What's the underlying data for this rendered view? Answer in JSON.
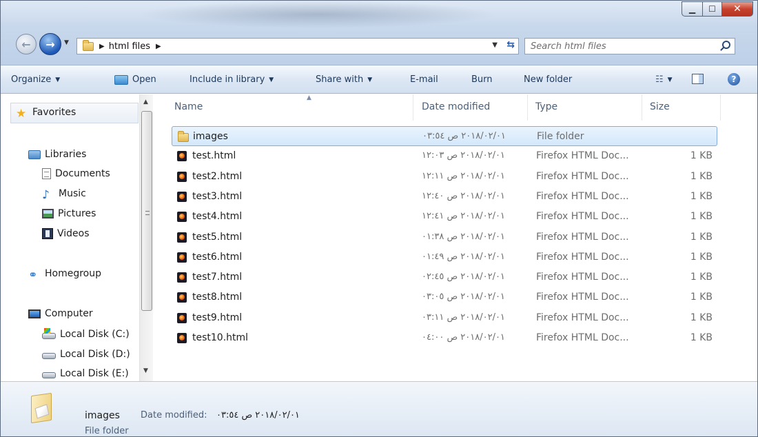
{
  "address": {
    "breadcrumbs": [
      "html files"
    ]
  },
  "search": {
    "placeholder": "Search html files"
  },
  "toolbar": {
    "organize": "Organize",
    "open": "Open",
    "include_in_library": "Include in library",
    "share_with": "Share with",
    "email": "E-mail",
    "burn": "Burn",
    "new_folder": "New folder"
  },
  "nav": {
    "favorites": "Favorites",
    "libraries": "Libraries",
    "documents": "Documents",
    "music": "Music",
    "pictures": "Pictures",
    "videos": "Videos",
    "homegroup": "Homegroup",
    "computer": "Computer",
    "disk_c": "Local Disk (C:)",
    "disk_d": "Local Disk (D:)",
    "disk_e": "Local Disk (E:)"
  },
  "columns": {
    "name": "Name",
    "date": "Date modified",
    "type": "Type",
    "size": "Size"
  },
  "files": [
    {
      "name": "images",
      "date": "٢٠١٨/٠٢/٠١ ص ٠٣:٥٤",
      "type": "File folder",
      "size": "",
      "kind": "folder",
      "selected": true
    },
    {
      "name": "test.html",
      "date": "٢٠١٨/٠٢/٠١ ص ١٢:٠٣",
      "type": "Firefox HTML Doc...",
      "size": "1 KB",
      "kind": "html"
    },
    {
      "name": "test2.html",
      "date": "٢٠١٨/٠٢/٠١ ص ١٢:١١",
      "type": "Firefox HTML Doc...",
      "size": "1 KB",
      "kind": "html"
    },
    {
      "name": "test3.html",
      "date": "٢٠١٨/٠٢/٠١ ص ١٢:٤٠",
      "type": "Firefox HTML Doc...",
      "size": "1 KB",
      "kind": "html"
    },
    {
      "name": "test4.html",
      "date": "٢٠١٨/٠٢/٠١ ص ١٢:٤١",
      "type": "Firefox HTML Doc...",
      "size": "1 KB",
      "kind": "html"
    },
    {
      "name": "test5.html",
      "date": "٢٠١٨/٠٢/٠١ ص ٠١:٣٨",
      "type": "Firefox HTML Doc...",
      "size": "1 KB",
      "kind": "html"
    },
    {
      "name": "test6.html",
      "date": "٢٠١٨/٠٢/٠١ ص ٠١:٤٩",
      "type": "Firefox HTML Doc...",
      "size": "1 KB",
      "kind": "html"
    },
    {
      "name": "test7.html",
      "date": "٢٠١٨/٠٢/٠١ ص ٠٢:٤٥",
      "type": "Firefox HTML Doc...",
      "size": "1 KB",
      "kind": "html"
    },
    {
      "name": "test8.html",
      "date": "٢٠١٨/٠٢/٠١ ص ٠٣:٠٥",
      "type": "Firefox HTML Doc...",
      "size": "1 KB",
      "kind": "html"
    },
    {
      "name": "test9.html",
      "date": "٢٠١٨/٠٢/٠١ ص ٠٣:١١",
      "type": "Firefox HTML Doc...",
      "size": "1 KB",
      "kind": "html"
    },
    {
      "name": "test10.html",
      "date": "٢٠١٨/٠٢/٠١ ص ٠٤:٠٠",
      "type": "Firefox HTML Doc...",
      "size": "1 KB",
      "kind": "html"
    }
  ],
  "details": {
    "name": "images",
    "date_label": "Date modified:",
    "date_value": "٢٠١٨/٠٢/٠١ ص ٠٣:٥٤",
    "type": "File folder"
  },
  "icons": {
    "back": "back-arrow-icon",
    "forward": "forward-arrow-icon",
    "refresh": "refresh-icon",
    "search": "search-icon",
    "help": "help-icon"
  },
  "colors": {
    "selection_border": "#84acdd",
    "selection_fill": "#d3e8fb",
    "toolbar_text": "#1e395b",
    "header_text": "#4c607a",
    "close_button": "#c8432e"
  }
}
